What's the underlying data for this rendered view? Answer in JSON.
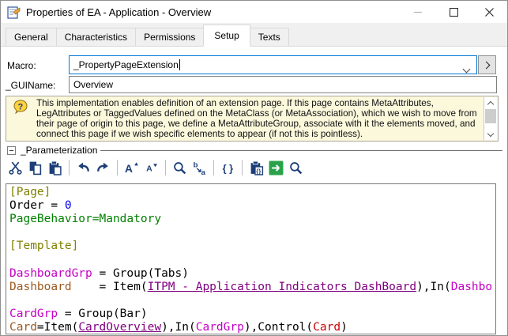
{
  "window": {
    "title": "Properties of EA - Application - Overview"
  },
  "tabs": [
    {
      "label": "General"
    },
    {
      "label": "Characteristics"
    },
    {
      "label": "Permissions"
    },
    {
      "label": "Setup"
    },
    {
      "label": "Texts"
    }
  ],
  "form": {
    "macro_label": "Macro:",
    "macro_value": "_PropertyPageExtension",
    "guiname_label": "_GUIName:",
    "guiname_value": "Overview"
  },
  "info_box": {
    "icon_glyph": "?",
    "text": "This implementation enables definition of an extension page. If this page contains MetaAttributes, LegAttributes or TaggedValues defined on the MetaClass (or MetaAssociation), which we wish to move from their page of origin to this page, we define a MetaAttributeGroup, associate with it the elements moved, and connect this page if we wish specific elements to appear (if not this is pointless)."
  },
  "section": {
    "label": "_Parameterization"
  },
  "toolbar": {
    "accent_color": "#1c3e78",
    "run_color": "#2aa24b",
    "items": [
      {
        "name": "cut",
        "svg": "<svg width='19' height='19' viewBox='0 0 18 18'><path d='M5 2 L13 12 M13 2 L5 12' stroke='#1c3e78' stroke-width='1.6' fill='none'/><circle cx='4.2' cy='14' r='2.1' fill='none' stroke='#1c3e78' stroke-width='1.5'/><circle cx='13.8' cy='14' r='2.1' fill='none' stroke='#1c3e78' stroke-width='1.5'/></svg>"
      },
      {
        "name": "copy",
        "svg": "<svg width='19' height='19' viewBox='0 0 18 18'><rect x='2.5' y='1.5' width='8' height='11' fill='#1c3e78'/><rect x='7.5' y='5.5' width='8' height='11' fill='#ffffff' stroke='#1c3e78' stroke-width='1.5'/></svg>"
      },
      {
        "name": "paste",
        "svg": "<svg width='19' height='19' viewBox='0 0 18 18'><rect x='2.5' y='3' width='11' height='13' fill='#1c3e78'/><rect x='5' y='1' width='6' height='3.5' fill='#1c3e78' stroke='#ffffff' stroke-width='0.8'/><rect x='8' y='7.5' width='8' height='9.5' fill='#ffffff' stroke='#1c3e78' stroke-width='1.4'/></svg>"
      },
      {
        "type": "sep"
      },
      {
        "name": "undo",
        "svg": "<svg width='19' height='19' viewBox='0 0 18 18'><path d='M15 13 Q14.5 6 7 6.5' fill='none' stroke='#1c3e78' stroke-width='2.2'/><path d='M8.5 2.5 L3 6.8 L8.8 10.5 Z' fill='#1c3e78'/></svg>"
      },
      {
        "name": "redo",
        "svg": "<svg width='19' height='19' viewBox='0 0 18 18'><path d='M3 13 Q3.5 6 11 6.5' fill='none' stroke='#1c3e78' stroke-width='2.2'/><path d='M9.5 2.5 L15 6.8 L9.2 10.5 Z' fill='#1c3e78'/></svg>"
      },
      {
        "type": "sep"
      },
      {
        "name": "font-increase",
        "svg": "<svg width='19' height='19' viewBox='0 0 18 18'><text x='1' y='14' font-size='13' font-weight='bold' fill='#1c3e78'>A</text><path d='M12.5 6 L14.7 2.2 L16.9 6 Z' fill='#1c3e78'/></svg>"
      },
      {
        "name": "font-decrease",
        "svg": "<svg width='19' height='19' viewBox='0 0 18 18'><text x='3' y='13' font-size='10' font-weight='bold' fill='#1c3e78'>A</text><path d='M11.5 4 L16.1 4 L13.8 7.8 Z' fill='#1c3e78'/></svg>"
      },
      {
        "type": "sep"
      },
      {
        "name": "zoom",
        "svg": "<svg width='19' height='19' viewBox='0 0 18 18'><circle cx='7.5' cy='7.5' r='4.6' fill='none' stroke='#1c3e78' stroke-width='1.7'/><line x1='11' y1='11' x2='15.5' y2='15.5' stroke='#1c3e78' stroke-width='2.3'/></svg>"
      },
      {
        "name": "replace",
        "svg": "<svg width='19' height='19' viewBox='0 0 18 18'><text x='1.5' y='8' font-size='9' font-weight='bold' fill='#1c3e78'>b</text><path d='M6 9.5 L10.5 13.5 M10.5 13.5 L7.5 13.2 M10.5 13.5 L10.2 10.5' stroke='#1c3e78' stroke-width='1.3' fill='none'/><text x='11' y='17' font-size='9' font-weight='bold' fill='#1c3e78'>a</text></svg>"
      },
      {
        "type": "sep"
      },
      {
        "name": "braces",
        "svg": "<svg width='19' height='19' viewBox='0 0 18 18'><text x='2.5' y='13.5' font-size='12' font-weight='bold' fill='#1c3e78'>{ }</text></svg>"
      },
      {
        "type": "sep"
      },
      {
        "name": "paste-special",
        "svg": "<svg width='19' height='19' viewBox='0 0 18 18'><rect x='2.5' y='3' width='11' height='13' fill='#1c3e78'/><rect x='5' y='1' width='6' height='3.5' fill='#1c3e78' stroke='#ffffff' stroke-width='0.8'/><rect x='7.5' y='7.5' width='9' height='9.5' fill='#ffffff' stroke='#1c3e78' stroke-width='1.3'/><text x='8.7' y='15.5' font-size='7.5' font-weight='bold' fill='#1c3e78'>{}</text></svg>"
      },
      {
        "name": "run",
        "svg": "<svg width='19' height='19' viewBox='0 0 18 18'><rect x='0.5' y='0.5' width='17' height='17' rx='1.5' fill='#2aa24b'/><path d='M4 9 H12.5 M12.5 9 L9.2 5.7 M12.5 9 L9.2 12.3' stroke='#ffffff' stroke-width='2' fill='none'/></svg>"
      },
      {
        "name": "search",
        "svg": "<svg width='19' height='19' viewBox='0 0 18 18'><circle cx='7.5' cy='7.5' r='4.6' fill='none' stroke='#1c3e78' stroke-width='1.7'/><line x1='11' y1='11' x2='15.5' y2='15.5' stroke='#1c3e78' stroke-width='2.3'/></svg>"
      }
    ]
  },
  "code": {
    "colors": {
      "section": "#808000",
      "plain": "#000000",
      "number": "#0000ee",
      "green": "#008000",
      "grp": "#c400c4",
      "item": "#9c5a21",
      "link": "#800080",
      "red": "#cc0000"
    },
    "lines": [
      [
        {
          "t": "[Page]",
          "c": "section"
        }
      ],
      [
        {
          "t": "Order = ",
          "c": "plain"
        },
        {
          "t": "0",
          "c": "number"
        }
      ],
      [
        {
          "t": "PageBehavior=Mandatory",
          "c": "green"
        }
      ],
      [],
      [
        {
          "t": "[Template]",
          "c": "section"
        }
      ],
      [],
      [
        {
          "t": "DashboardGrp",
          "c": "grp"
        },
        {
          "t": " = Group(Tabs)",
          "c": "plain"
        }
      ],
      [
        {
          "t": "Dashboard",
          "c": "item"
        },
        {
          "t": "    = Item(",
          "c": "plain"
        },
        {
          "t": "ITPM - Application Indicators DashBoard",
          "c": "link",
          "u": true
        },
        {
          "t": "),In(",
          "c": "plain"
        },
        {
          "t": "Dashbo",
          "c": "grp"
        }
      ],
      [],
      [
        {
          "t": "CardGrp",
          "c": "grp"
        },
        {
          "t": " = Group(Bar)",
          "c": "plain"
        }
      ],
      [
        {
          "t": "Card",
          "c": "item"
        },
        {
          "t": "=Item(",
          "c": "plain"
        },
        {
          "t": "CardOverview",
          "c": "link",
          "u": true
        },
        {
          "t": "),In(",
          "c": "plain"
        },
        {
          "t": "CardGrp",
          "c": "grp"
        },
        {
          "t": "),Control(",
          "c": "plain"
        },
        {
          "t": "Card",
          "c": "red"
        },
        {
          "t": ")",
          "c": "plain"
        }
      ]
    ]
  }
}
